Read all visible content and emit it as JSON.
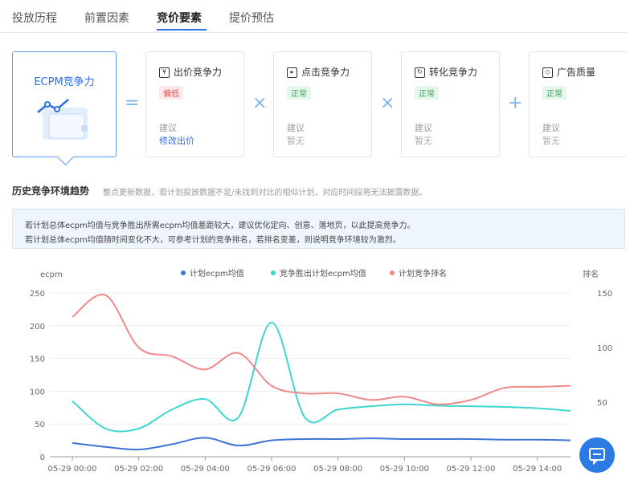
{
  "tabs": [
    {
      "label": "投放历程"
    },
    {
      "label": "前置因素"
    },
    {
      "label": "竞价要素"
    },
    {
      "label": "提价预估"
    }
  ],
  "main_card": {
    "title": "ECPM竞争力"
  },
  "operators": [
    "=",
    "×",
    "×",
    "+"
  ],
  "factors": [
    {
      "title": "出价竞争力",
      "status": "偏低",
      "suggestion_label": "建议",
      "suggestion": "修改出价"
    },
    {
      "title": "点击竞争力",
      "status": "正常",
      "suggestion_label": "建议",
      "suggestion": "暂无"
    },
    {
      "title": "转化竞争力",
      "status": "正常",
      "suggestion_label": "建议",
      "suggestion": "暂无"
    },
    {
      "title": "广告质量",
      "status": "正常",
      "suggestion_label": "建议",
      "suggestion": "暂无"
    }
  ],
  "history": {
    "title": "历史竞争环境趋势",
    "note": "整点更新数据，若计划投放数据不足/未找到对比的相似计划，对应时间段将无法披露数据。",
    "info_lines": [
      "若计划总体ecpm均值与竞争胜出所需ecpm均值差距较大，建议优化定向、创意、落地页，以此提高竞争力。",
      "若计划总体ecpm均值随时间变化不大，可参考计划的竞争排名，若排名变差，则说明竞争环境较为激烈。"
    ]
  },
  "colors": {
    "accent": "#2c6fe8",
    "series_blue": "#3d74d6",
    "series_cyan": "#3dd6d0",
    "series_pink": "#f08a8a"
  },
  "chart_data": {
    "type": "line",
    "x": [
      "05-29 00:00",
      "05-29 01:00",
      "05-29 02:00",
      "05-29 03:00",
      "05-29 04:00",
      "05-29 05:00",
      "05-29 06:00",
      "05-29 07:00",
      "05-29 08:00",
      "05-29 09:00",
      "05-29 10:00",
      "05-29 11:00",
      "05-29 12:00",
      "05-29 13:00",
      "05-29 14:00",
      "05-29 15:00"
    ],
    "x_tick_labels": [
      "05-29 00:00",
      "05-29 02:00",
      "05-29 04:00",
      "05-29 06:00",
      "05-29 08:00",
      "05-29 10:00",
      "05-29 12:00",
      "05-29 14:00"
    ],
    "ylabel_left": "ecpm",
    "ylabel_right": "排名",
    "ylim_left": [
      0,
      250
    ],
    "yticks_left": [
      0,
      50,
      100,
      150,
      200,
      250
    ],
    "ylim_right": [
      0,
      150
    ],
    "yticks_right": [
      50,
      100,
      150
    ],
    "legend_position": "top-center",
    "grid": "horizontal",
    "series": [
      {
        "name": "计划ecpm均值",
        "axis": "left",
        "color": "#3d74d6",
        "values": [
          21,
          15,
          11,
          19,
          29,
          17,
          25,
          27,
          27,
          28,
          27,
          27,
          27,
          26,
          26,
          25
        ]
      },
      {
        "name": "竞争胜出计划ecpm均值",
        "axis": "left",
        "color": "#3dd6d0",
        "values": [
          85,
          43,
          43,
          72,
          88,
          60,
          205,
          60,
          72,
          77,
          80,
          78,
          77,
          76,
          74,
          70
        ]
      },
      {
        "name": "计划竞争排名",
        "axis": "right",
        "color": "#f08a8a",
        "values": [
          128,
          148,
          100,
          92,
          80,
          95,
          65,
          58,
          58,
          52,
          55,
          48,
          52,
          63,
          64,
          65
        ]
      }
    ]
  }
}
